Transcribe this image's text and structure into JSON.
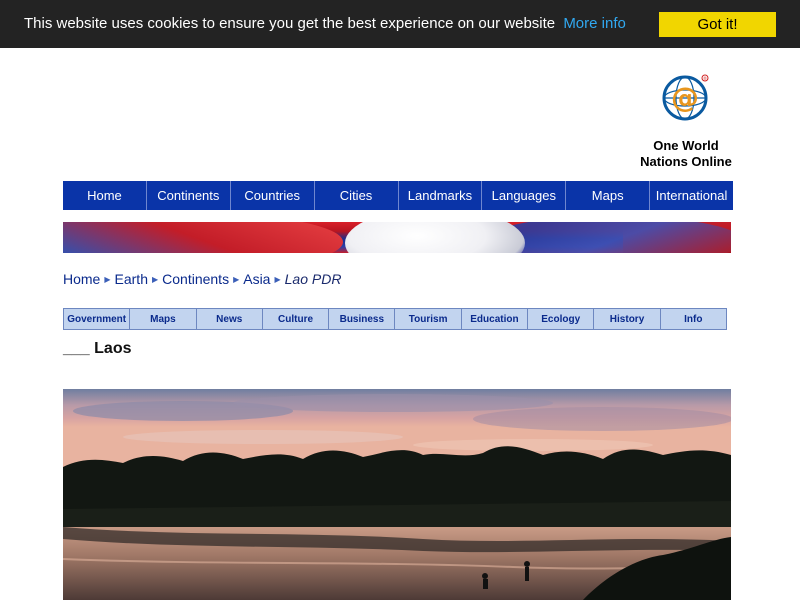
{
  "cookie": {
    "message": "This website uses cookies to ensure you get the best experience on our website",
    "more_info": "More info",
    "accept": "Got it!",
    "bar_color": "#232323",
    "button_color": "#f1d600",
    "link_color": "#31a8f0"
  },
  "logo": {
    "line1": "One World",
    "line2": "Nations Online",
    "icon": "at-globe-logo"
  },
  "main_nav": {
    "color": "#0a34a8",
    "items": [
      "Home",
      "Continents",
      "Countries",
      "Cities",
      "Landmarks",
      "Languages",
      "Maps",
      "International"
    ]
  },
  "breadcrumb": {
    "items": [
      "Home",
      "Earth",
      "Continents",
      "Asia"
    ],
    "current": "Lao PDR"
  },
  "sub_nav": {
    "color": "#c2d4ef",
    "items": [
      "Government",
      "Maps",
      "News",
      "Culture",
      "Business",
      "Tourism",
      "Education",
      "Ecology",
      "History",
      "Info"
    ]
  },
  "page": {
    "title": "___ Laos"
  }
}
